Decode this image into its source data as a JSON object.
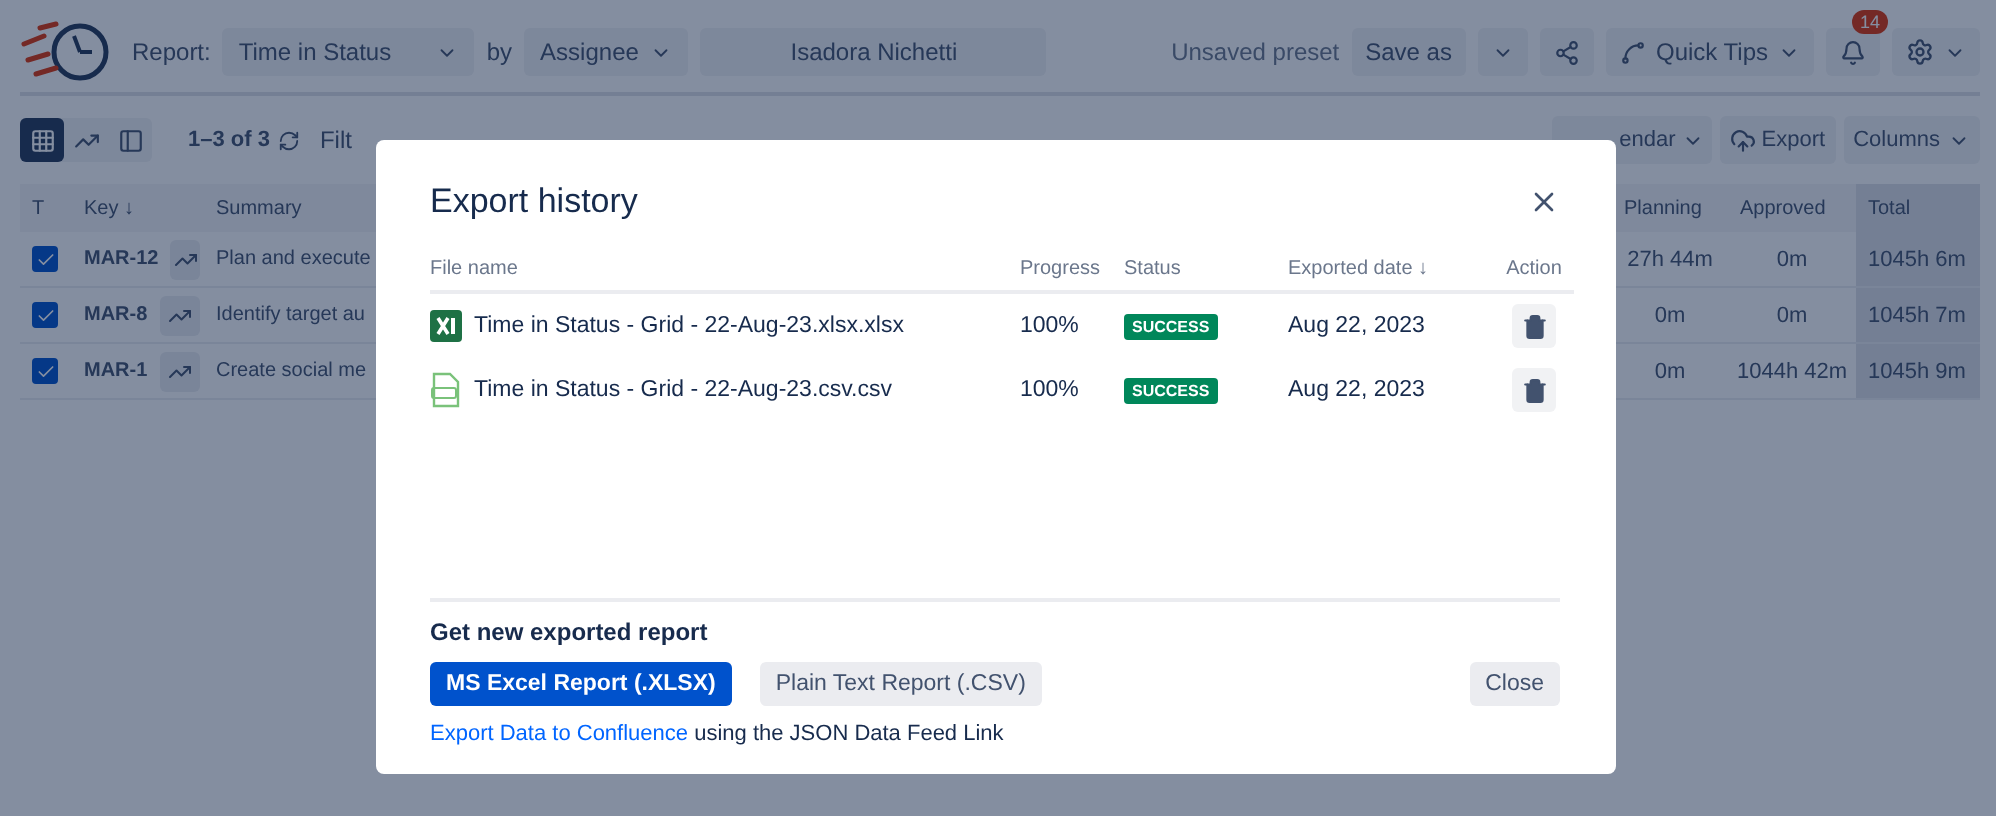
{
  "header": {
    "report_label": "Report:",
    "report_value": "Time in Status",
    "by_label": "by",
    "group_value": "Assignee",
    "user_value": "Isadora Nichetti",
    "preset_status": "Unsaved preset",
    "save_as": "Save as",
    "quick_tips": "Quick Tips",
    "notifications_count": "14"
  },
  "toolbar": {
    "views": [
      {
        "kind": "grid",
        "selected": true
      },
      {
        "kind": "chart",
        "selected": false
      },
      {
        "kind": "panel",
        "selected": false
      }
    ],
    "count": "1–3 of 3",
    "filter_label": "Filt",
    "calendar": "endar",
    "export": "Export",
    "columns": "Columns"
  },
  "table": {
    "columns": [
      "T",
      "Key ↓",
      "Summary",
      "Planning",
      "Approved",
      "Total"
    ],
    "rows": [
      {
        "checked": true,
        "key": "MAR-12",
        "summary": "Plan and execute",
        "planning": "27h 44m",
        "approved": "0m",
        "total": "1045h 6m"
      },
      {
        "checked": true,
        "key": "MAR-8",
        "summary": "Identify target au",
        "planning": "0m",
        "approved": "0m",
        "total": "1045h 7m"
      },
      {
        "checked": true,
        "key": "MAR-1",
        "summary": "Create social me",
        "planning": "0m",
        "approved": "1044h 42m",
        "total": "1045h 9m"
      }
    ]
  },
  "modal": {
    "title": "Export history",
    "columns": [
      "File name",
      "Progress",
      "Status",
      "Exported date ↓",
      "Action"
    ],
    "files": [
      {
        "kind": "xlsx",
        "name": "Time in Status - Grid - 22-Aug-23.xlsx.xlsx",
        "progress": "100%",
        "status": "SUCCESS",
        "date": "Aug 22, 2023"
      },
      {
        "kind": "csv",
        "name": "Time in Status - Grid - 22-Aug-23.csv.csv",
        "progress": "100%",
        "status": "SUCCESS",
        "date": "Aug 22, 2023"
      }
    ],
    "footer": {
      "heading": "Get new exported report",
      "buttons": [
        {
          "label": "MS Excel Report (.XLSX)",
          "kind": "primary"
        },
        {
          "label": "Plain Text Report (.CSV)",
          "kind": "secondary"
        }
      ],
      "close": "Close",
      "link": "Export Data to Confluence",
      "link_suffix": "using the JSON Data Feed Link"
    }
  }
}
